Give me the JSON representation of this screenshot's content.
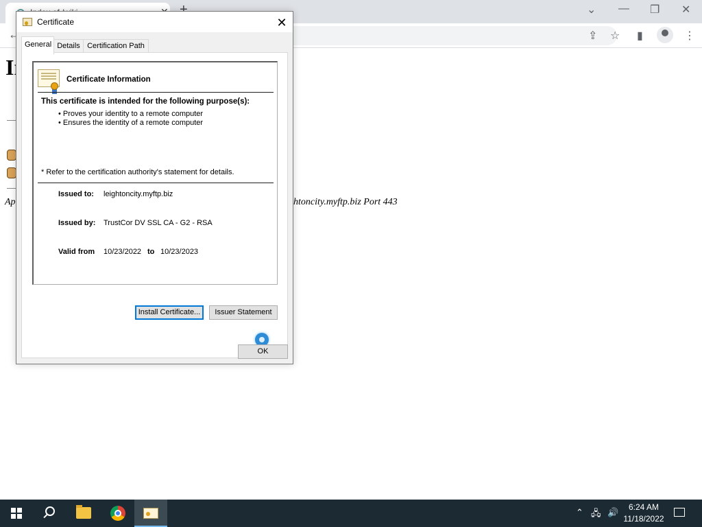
{
  "browser": {
    "tab_title": "Index of /wiki",
    "tab_close": "✕",
    "new_tab": "+",
    "minimize": "—",
    "restore": "❐",
    "close": "✕",
    "back": "←"
  },
  "page": {
    "heading_fragment": "In",
    "address_left": "Ap",
    "address_right": "htoncity.myftp.biz Port 443"
  },
  "dialog": {
    "title": "Certificate",
    "close": "✕",
    "tabs": [
      "General",
      "Details",
      "Certification Path"
    ],
    "info_heading": "Certificate Information",
    "purpose_heading": "This certificate is intended for the following purpose(s):",
    "purposes": [
      "Proves your identity to a remote computer",
      "Ensures the identity of a remote computer"
    ],
    "refer_note": "* Refer to the certification authority's statement for details.",
    "issued_to_label": "Issued to:",
    "issued_to_value": "leightoncity.myftp.biz",
    "issued_by_label": "Issued by:",
    "issued_by_value": "TrustCor DV SSL CA - G2 - RSA",
    "valid_from_label": "Valid from",
    "valid_from_value": "10/23/2022",
    "valid_to_label": "to",
    "valid_to_value": "10/23/2023",
    "install_button": "Install Certificate...",
    "issuer_button": "Issuer Statement",
    "ok_button": "OK"
  },
  "taskbar": {
    "time": "6:24 AM",
    "date": "11/18/2022",
    "tray_chevron": "⌃",
    "network": "🖧",
    "volume": "🔊"
  }
}
